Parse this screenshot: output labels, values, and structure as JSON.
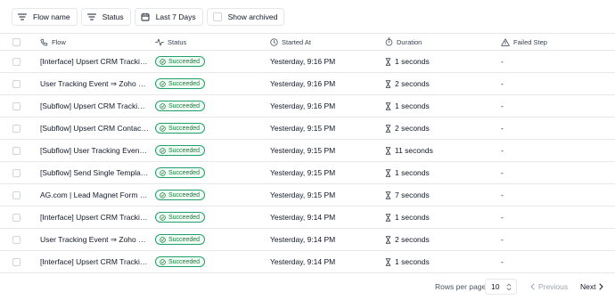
{
  "filters": {
    "flow_name": "Flow name",
    "status": "Status",
    "date_range": "Last 7 Days",
    "show_archived": "Show archived"
  },
  "table": {
    "headers": {
      "flow": "Flow",
      "status": "Status",
      "started_at": "Started At",
      "duration": "Duration",
      "failed_step": "Failed Step"
    },
    "rows": [
      {
        "flow": "[Interface] Upsert CRM Tracking Event",
        "status": "Succeeded",
        "started_at": "Yesterday, 9:16 PM",
        "duration": "1 seconds",
        "failed_step": "-"
      },
      {
        "flow": "User Tracking Event ⇒ Zoho CRM",
        "status": "Succeeded",
        "started_at": "Yesterday, 9:16 PM",
        "duration": "2 seconds",
        "failed_step": "-"
      },
      {
        "flow": "[Subflow] Upsert CRM Tracking Event",
        "status": "Succeeded",
        "started_at": "Yesterday, 9:16 PM",
        "duration": "1 seconds",
        "failed_step": "-"
      },
      {
        "flow": "[Subflow] Upsert CRM Contact Record",
        "status": "Succeeded",
        "started_at": "Yesterday, 9:15 PM",
        "duration": "2 seconds",
        "failed_step": "-"
      },
      {
        "flow": "[Subflow] User Tracking Event ⇒ CRM",
        "status": "Succeeded",
        "started_at": "Yesterday, 9:15 PM",
        "duration": "11 seconds",
        "failed_step": "-"
      },
      {
        "flow": "[Subflow] Send Single Templated Email",
        "status": "Succeeded",
        "started_at": "Yesterday, 9:15 PM",
        "duration": "1 seconds",
        "failed_step": "-"
      },
      {
        "flow": "AG.com | Lead Magnet Form ⇒ Zoho CRM",
        "status": "Succeeded",
        "started_at": "Yesterday, 9:15 PM",
        "duration": "7 seconds",
        "failed_step": "-"
      },
      {
        "flow": "[Interface] Upsert CRM Tracking Event",
        "status": "Succeeded",
        "started_at": "Yesterday, 9:14 PM",
        "duration": "1 seconds",
        "failed_step": "-"
      },
      {
        "flow": "User Tracking Event ⇒ Zoho CRM",
        "status": "Succeeded",
        "started_at": "Yesterday, 9:14 PM",
        "duration": "2 seconds",
        "failed_step": "-"
      },
      {
        "flow": "[Interface] Upsert CRM Tracking Event",
        "status": "Succeeded",
        "started_at": "Yesterday, 9:14 PM",
        "duration": "1 seconds",
        "failed_step": "-"
      }
    ]
  },
  "pagination": {
    "rows_per_page_label": "Rows per page",
    "rows_per_page_value": "10",
    "previous_label": "Previous",
    "next_label": "Next"
  },
  "colors": {
    "success_border": "#22a06b",
    "success_text": "#15803d",
    "border": "#e5e7eb"
  },
  "icons": {
    "flow_name_filter": "filter-lines-icon",
    "status_filter": "filter-lines-icon",
    "date_filter": "calendar-icon",
    "flow_header": "phone-flow-icon",
    "status_header": "activity-icon",
    "started_header": "clock-icon",
    "duration_header": "stopwatch-icon",
    "failed_header": "warning-triangle-icon",
    "badge": "check-circle-icon",
    "duration_cell": "hourglass-icon"
  }
}
